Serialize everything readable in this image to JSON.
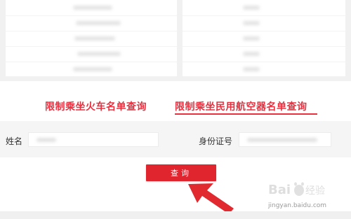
{
  "tabs": [
    {
      "label": "限制乘坐火车名单查询",
      "active": false
    },
    {
      "label": "限制乘坐民用航空器名单查询",
      "active": true
    }
  ],
  "form": {
    "name_label": "姓名",
    "name_value": "",
    "id_label": "身份证号",
    "id_value": ""
  },
  "actions": {
    "query_label": "查询"
  },
  "watermark": {
    "logo_text": "Baidu经验",
    "url": "jingyan.baidu.com"
  },
  "colors": {
    "accent": "#e8303f",
    "button": "#e0252f",
    "arrow": "#e02a2f"
  },
  "icons": {
    "pointer": "arrow-annotation-icon"
  }
}
